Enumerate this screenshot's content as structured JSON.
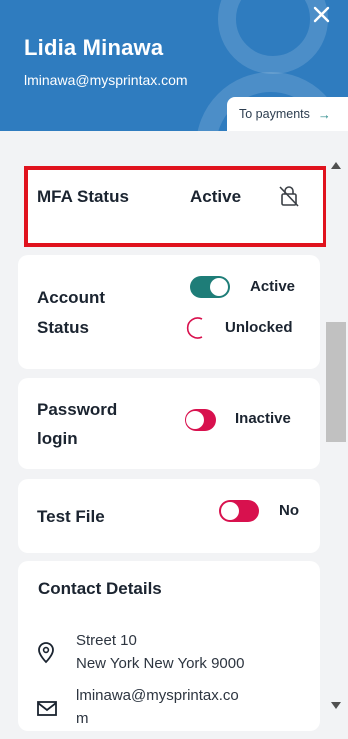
{
  "header": {
    "name": "Lidia Minawa",
    "email": "lminawa@mysprintax.com",
    "to_payments_label": "To payments",
    "to_payments_arrow": "→",
    "close_label": "×"
  },
  "mfa": {
    "label": "MFA Status",
    "value": "Active"
  },
  "account_status": {
    "label_line1": "Account",
    "label_line2": "Status",
    "active_label": "Active",
    "active_on": true,
    "lock_label": "Unlocked"
  },
  "password_login": {
    "label_line1": "Password",
    "label_line2": "login",
    "value": "Inactive",
    "on": false
  },
  "test_file": {
    "label": "Test File",
    "value": "No",
    "on": false
  },
  "contact": {
    "title": "Contact Details",
    "address_line1": "Street 10",
    "address_line2": "New York New York 9000",
    "email_line1": "lminawa@mysprintax.co",
    "email_line2": "m"
  },
  "colors": {
    "header": "#2f7cbf",
    "toggle_on": "#1e7d78",
    "toggle_off": "#d8114e",
    "highlight": "#e0121d"
  }
}
